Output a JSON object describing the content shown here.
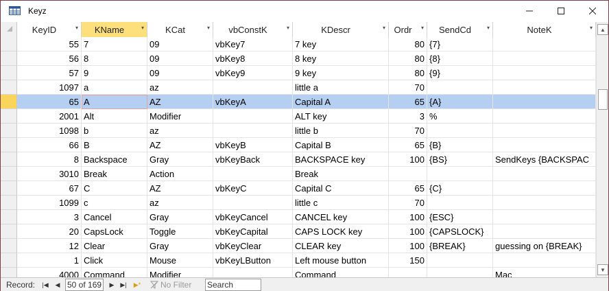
{
  "window": {
    "title": "Keyz"
  },
  "grid": {
    "columns": [
      {
        "label": "KeyID",
        "align": "num"
      },
      {
        "label": "KName",
        "align": "txt"
      },
      {
        "label": "KCat",
        "align": "txt"
      },
      {
        "label": "vbConstK",
        "align": "txt"
      },
      {
        "label": "KDescr",
        "align": "txt"
      },
      {
        "label": "Ordr",
        "align": "num"
      },
      {
        "label": "SendCd",
        "align": "txt"
      },
      {
        "label": "NoteK",
        "align": "txt"
      }
    ],
    "sorted_column": "KName",
    "rows": [
      [
        "55",
        "7",
        "09",
        "vbKey7",
        "7 key",
        "80",
        "{7}",
        ""
      ],
      [
        "56",
        "8",
        "09",
        "vbKey8",
        "8 key",
        "80",
        "{8}",
        ""
      ],
      [
        "57",
        "9",
        "09",
        "vbKey9",
        "9 key",
        "80",
        "{9}",
        ""
      ],
      [
        "1097",
        "a",
        "az",
        "",
        "little a",
        "70",
        "",
        ""
      ],
      [
        "65",
        "A",
        "AZ",
        "vbKeyA",
        "Capital A",
        "65",
        "{A}",
        ""
      ],
      [
        "2001",
        "Alt",
        "Modifier",
        "",
        "ALT key",
        "3",
        "%",
        ""
      ],
      [
        "1098",
        "b",
        "az",
        "",
        "little b",
        "70",
        "",
        ""
      ],
      [
        "66",
        "B",
        "AZ",
        "vbKeyB",
        "Capital B",
        "65",
        "{B}",
        ""
      ],
      [
        "8",
        "Backspace",
        "Gray",
        "vbKeyBack",
        "BACKSPACE key",
        "100",
        "{BS}",
        "SendKeys {BACKSPAC"
      ],
      [
        "3010",
        "Break",
        "Action",
        "",
        "Break",
        "",
        "",
        ""
      ],
      [
        "67",
        "C",
        "AZ",
        "vbKeyC",
        "Capital C",
        "65",
        "{C}",
        ""
      ],
      [
        "1099",
        "c",
        "az",
        "",
        "little c",
        "70",
        "",
        ""
      ],
      [
        "3",
        "Cancel",
        "Gray",
        "vbKeyCancel",
        "CANCEL key",
        "100",
        "{ESC}",
        ""
      ],
      [
        "20",
        "CapsLock",
        "Toggle",
        "vbKeyCapital",
        "CAPS LOCK key",
        "100",
        "{CAPSLOCK}",
        ""
      ],
      [
        "12",
        "Clear",
        "Gray",
        "vbKeyClear",
        "CLEAR key",
        "100",
        "{BREAK}",
        "guessing on {BREAK}"
      ],
      [
        "1",
        "Click",
        "Mouse",
        "vbKeyLButton",
        "Left mouse button",
        "150",
        "",
        ""
      ],
      [
        "4000",
        "Command",
        "Modifier",
        "",
        "Command",
        "",
        "",
        "Mac"
      ]
    ],
    "current_row_index": 4
  },
  "navbar": {
    "record_label": "Record:",
    "record_value": "50 of 169",
    "filter_label": "No Filter",
    "search_placeholder": "Search"
  },
  "icons": {
    "app": "table-icon",
    "minimize": "minimize-icon",
    "maximize": "maximize-icon",
    "close": "close-icon",
    "filter": "filter-icon"
  },
  "colors": {
    "current_row": "#b4cff2",
    "selected_header": "#fde07b",
    "selector_current": "#fad55c",
    "window_border": "#7a3e4a"
  }
}
